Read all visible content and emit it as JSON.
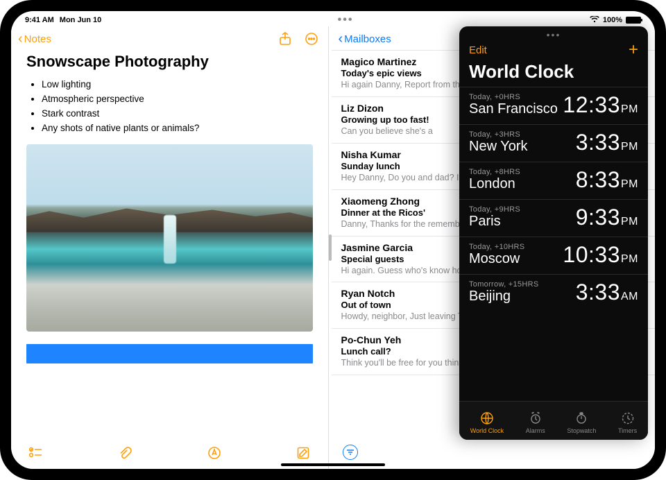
{
  "status": {
    "time": "9:41 AM",
    "date": "Mon Jun 10",
    "battery_pct": "100%"
  },
  "notes": {
    "back_label": "Notes",
    "title": "Snowscape Photography",
    "bullets": [
      "Low lighting",
      "Atmospheric perspective",
      "Stark contrast",
      "Any shots of native plants or animals?"
    ]
  },
  "mail": {
    "back_label": "Mailboxes",
    "items": [
      {
        "from": "Magico Martinez",
        "subject": "Today's epic views",
        "preview": "Hi again Danny, Report from the field. Wide open skies, a ger"
      },
      {
        "from": "Liz Dizon",
        "subject": "Growing up too fast!",
        "preview": "Can you believe she's a"
      },
      {
        "from": "Nisha Kumar",
        "subject": "Sunday lunch",
        "preview": "Hey Danny, Do you and dad? If you two join, th"
      },
      {
        "from": "Xiaomeng Zhong",
        "subject": "Dinner at the Ricos'",
        "preview": "Danny, Thanks for the remembered to take or"
      },
      {
        "from": "Jasmine Garcia",
        "subject": "Special guests",
        "preview": "Hi again. Guess who's know how to make me"
      },
      {
        "from": "Ryan Notch",
        "subject": "Out of town",
        "preview": "Howdy, neighbor, Just leaving Tuesday and w"
      },
      {
        "from": "Po-Chun Yeh",
        "subject": "Lunch call?",
        "preview": "Think you'll be free for you think might work a"
      }
    ]
  },
  "clock": {
    "edit_label": "Edit",
    "title": "World Clock",
    "rows": [
      {
        "relative": "Today, +0HRS",
        "city": "San Francisco",
        "time": "12:33",
        "ampm": "PM"
      },
      {
        "relative": "Today, +3HRS",
        "city": "New York",
        "time": "3:33",
        "ampm": "PM"
      },
      {
        "relative": "Today, +8HRS",
        "city": "London",
        "time": "8:33",
        "ampm": "PM"
      },
      {
        "relative": "Today, +9HRS",
        "city": "Paris",
        "time": "9:33",
        "ampm": "PM"
      },
      {
        "relative": "Today, +10HRS",
        "city": "Moscow",
        "time": "10:33",
        "ampm": "PM"
      },
      {
        "relative": "Tomorrow, +15HRS",
        "city": "Beijing",
        "time": "3:33",
        "ampm": "AM"
      }
    ],
    "tabs": [
      {
        "label": "World Clock",
        "active": true
      },
      {
        "label": "Alarms",
        "active": false
      },
      {
        "label": "Stopwatch",
        "active": false
      },
      {
        "label": "Timers",
        "active": false
      }
    ]
  }
}
